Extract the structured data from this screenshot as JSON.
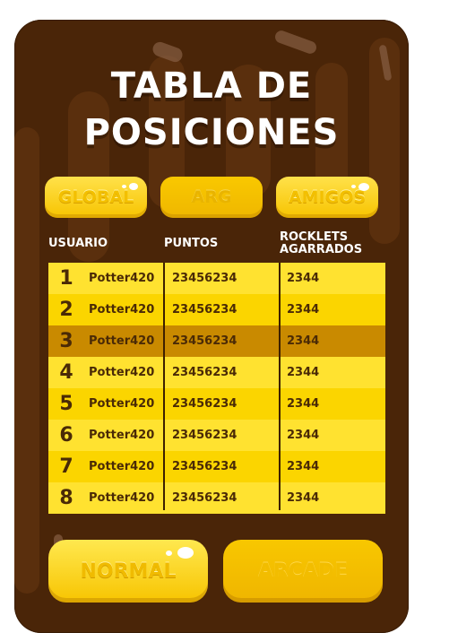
{
  "title_line1": "TABLA DE",
  "title_line2": "POSICIONES",
  "tabs": [
    {
      "label": "GLOBAL"
    },
    {
      "label": "ARG"
    },
    {
      "label": "AMIGOS"
    }
  ],
  "columns": {
    "usuario": "USUARIO",
    "puntos": "PUNTOS",
    "rocklets_line1": "ROCKLETS",
    "rocklets_line2": "AGARRADOS"
  },
  "rows": [
    {
      "rank": "1",
      "user": "Potter420",
      "points": "23456234",
      "rocklets": "2344"
    },
    {
      "rank": "2",
      "user": "Potter420",
      "points": "23456234",
      "rocklets": "2344"
    },
    {
      "rank": "3",
      "user": "Potter420",
      "points": "23456234",
      "rocklets": "2344"
    },
    {
      "rank": "4",
      "user": "Potter420",
      "points": "23456234",
      "rocklets": "2344"
    },
    {
      "rank": "5",
      "user": "Potter420",
      "points": "23456234",
      "rocklets": "2344"
    },
    {
      "rank": "6",
      "user": "Potter420",
      "points": "23456234",
      "rocklets": "2344"
    },
    {
      "rank": "7",
      "user": "Potter420",
      "points": "23456234",
      "rocklets": "2344"
    },
    {
      "rank": "8",
      "user": "Potter420",
      "points": "23456234",
      "rocklets": "2344"
    }
  ],
  "buttons": {
    "normal": "NORMAL",
    "arcade": "ARCADE"
  },
  "colors": {
    "panel_bg": "#4a2508",
    "accent_yellow": "#ffe230",
    "highlight_row": "#c98a00",
    "text_dark": "#4a2a06"
  }
}
